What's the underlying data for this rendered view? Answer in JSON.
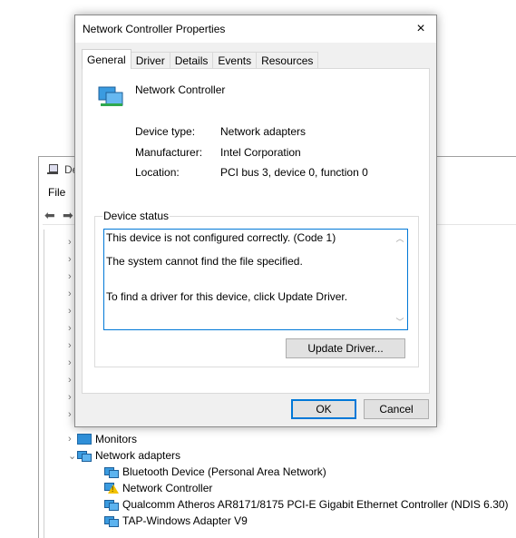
{
  "background_window": {
    "title": "De",
    "menu_file": "File",
    "tree": {
      "monitors": "Monitors",
      "network_adapters": "Network adapters",
      "children": [
        "Bluetooth Device (Personal Area Network)",
        "Network Controller",
        "Qualcomm Atheros AR8171/8175 PCI-E Gigabit Ethernet Controller (NDIS 6.30)",
        "TAP-Windows Adapter V9"
      ]
    }
  },
  "dialog": {
    "title": "Network Controller Properties",
    "close_icon": "×",
    "tabs": [
      "General",
      "Driver",
      "Details",
      "Events",
      "Resources"
    ],
    "device_name": "Network Controller",
    "properties": {
      "device_type_label": "Device type:",
      "device_type_value": "Network adapters",
      "manufacturer_label": "Manufacturer:",
      "manufacturer_value": "Intel Corporation",
      "location_label": "Location:",
      "location_value": "PCI bus 3, device 0, function 0"
    },
    "device_status": {
      "legend": "Device status",
      "lines": [
        "This device is not configured correctly. (Code 1)",
        "The system cannot find the file specified.",
        "To find a driver for this device, click Update Driver."
      ]
    },
    "update_driver_label": "Update Driver...",
    "ok_label": "OK",
    "cancel_label": "Cancel"
  }
}
